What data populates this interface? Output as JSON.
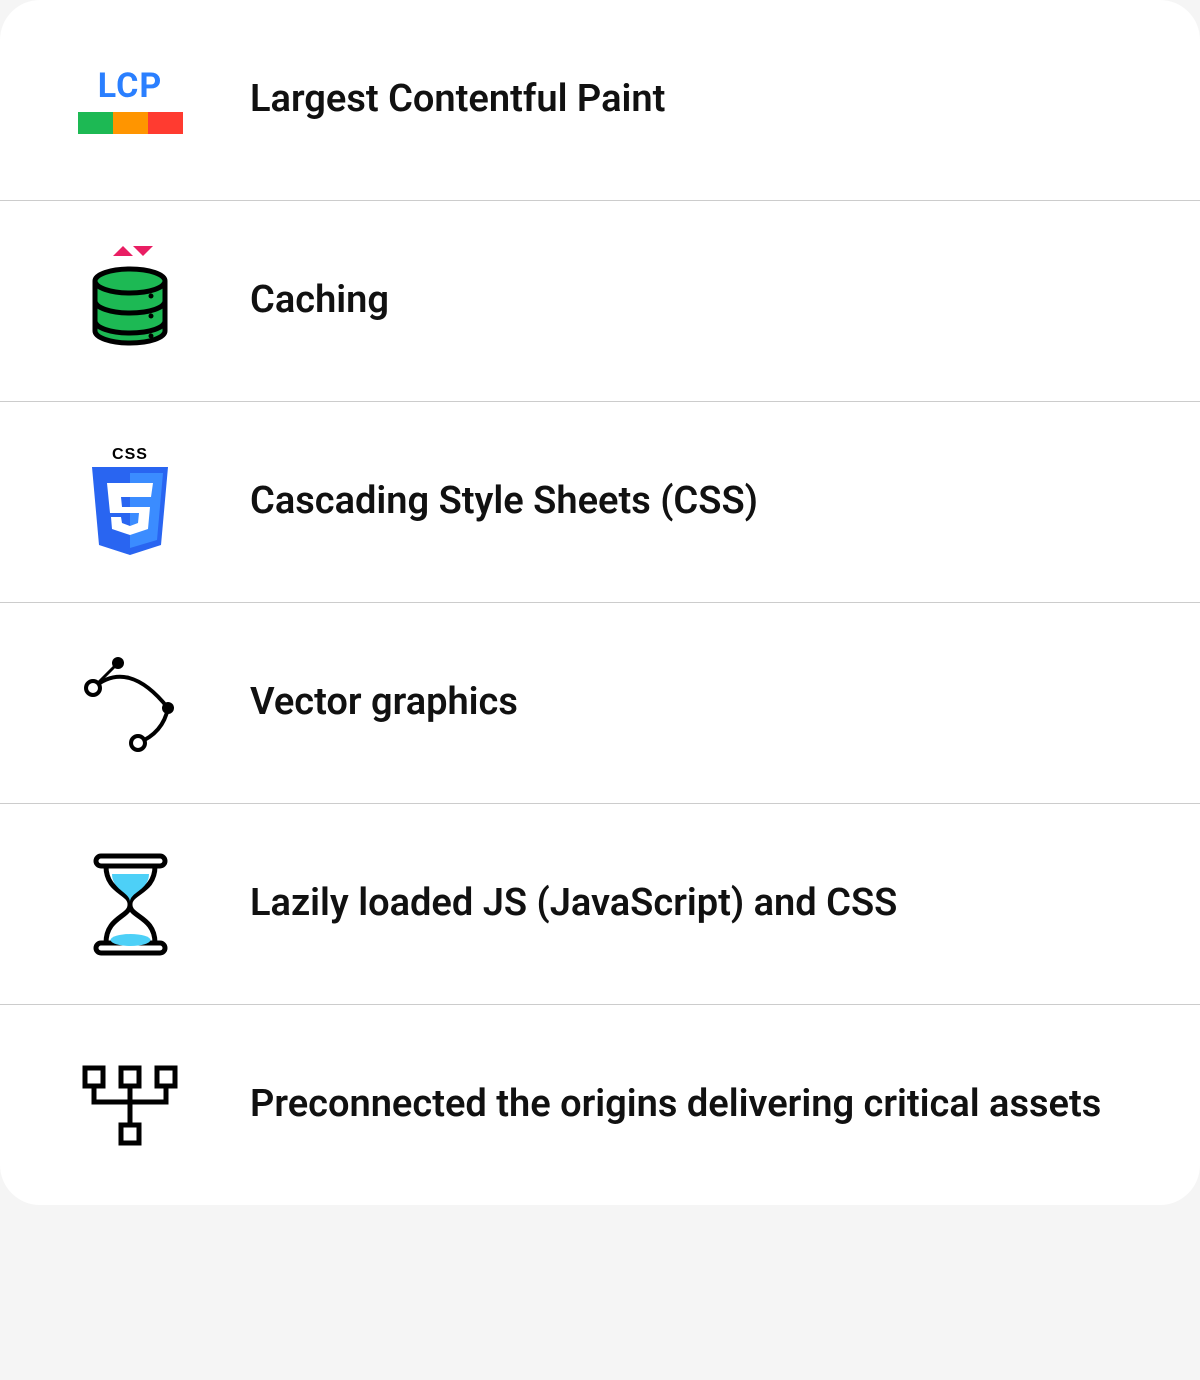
{
  "items": [
    {
      "label": "Largest Contentful Paint",
      "icon_text": "LCP"
    },
    {
      "label": "Caching"
    },
    {
      "label": "Cascading Style Sheets (CSS)",
      "icon_text": "CSS"
    },
    {
      "label": "Vector graphics"
    },
    {
      "label": "Lazily loaded JS (JavaScript) and CSS"
    },
    {
      "label": "Preconnected the origins delivering critical assets"
    }
  ],
  "colors": {
    "lcp_blue": "#2a7fff",
    "lcp_green": "#1db954",
    "lcp_orange": "#ff9500",
    "lcp_red": "#ff3b30",
    "db_green": "#1db954",
    "css_blue": "#2965f1",
    "pink": "#e91e63",
    "hourglass_sand": "#4dd0f7"
  }
}
